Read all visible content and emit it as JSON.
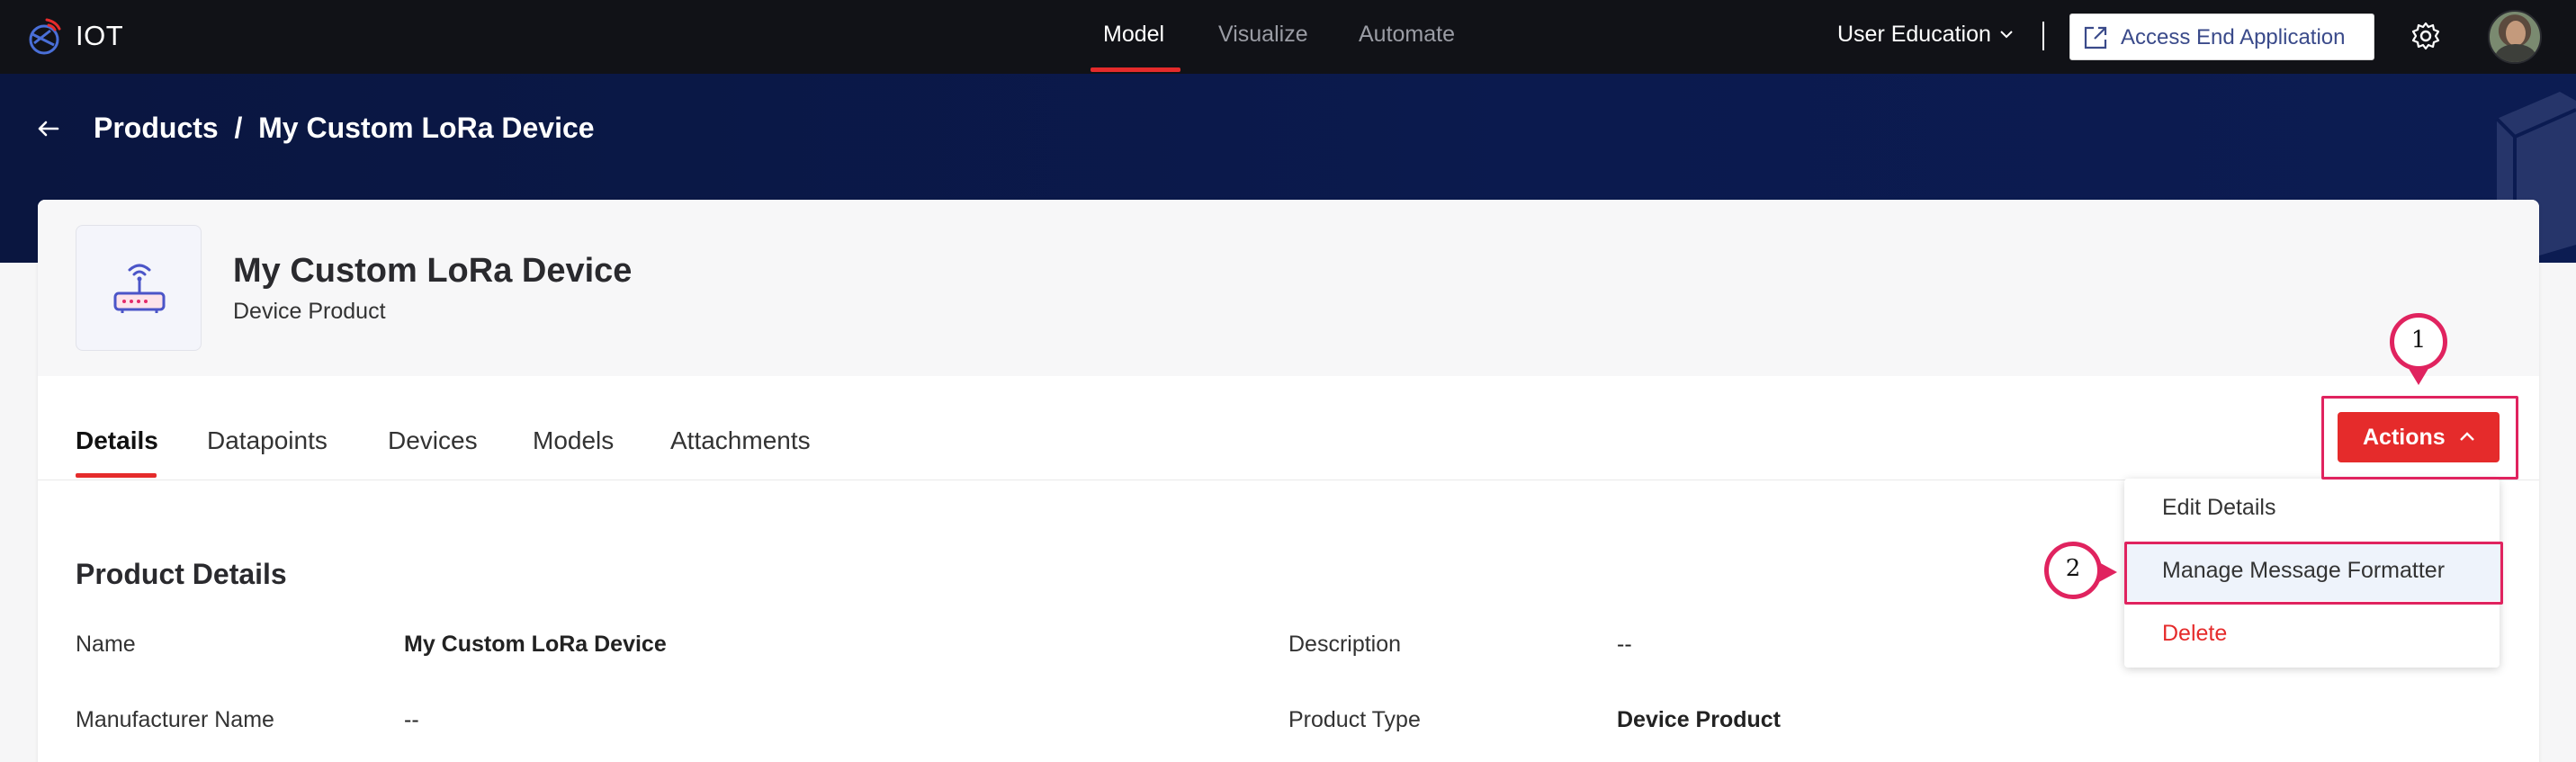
{
  "app": {
    "name": "IOT",
    "logo_icon": "zoho-iot-logo-icon"
  },
  "top_nav": {
    "items": [
      {
        "label": "Model",
        "active": true
      },
      {
        "label": "Visualize",
        "active": false
      },
      {
        "label": "Automate",
        "active": false
      }
    ],
    "org_label": "User Education",
    "access_button_label": "Access End Application",
    "settings_icon": "gear-icon"
  },
  "header": {
    "breadcrumb": "Products  /  My Custom LoRa Device",
    "back_icon": "arrow-left-icon"
  },
  "product": {
    "title": "My Custom LoRa Device",
    "subtitle": "Device Product",
    "icon": "router-icon"
  },
  "tabs": [
    {
      "label": "Details",
      "active": true
    },
    {
      "label": "Datapoints",
      "active": false
    },
    {
      "label": "Devices",
      "active": false
    },
    {
      "label": "Models",
      "active": false
    },
    {
      "label": "Attachments",
      "active": false
    }
  ],
  "actions": {
    "label": "Actions",
    "menu": [
      {
        "label": "Edit Details"
      },
      {
        "label": "Manage Message Formatter"
      },
      {
        "label": "Delete"
      }
    ]
  },
  "details": {
    "section_title": "Product Details",
    "rows": [
      {
        "label": "Name",
        "value": "My Custom LoRa Device"
      },
      {
        "label": "Description",
        "value": "--"
      },
      {
        "label": "Manufacturer Name",
        "value": "--"
      },
      {
        "label": "Product Type",
        "value": "Device Product"
      }
    ]
  },
  "annotations": {
    "step1": "1",
    "step2": "2",
    "color": "#e0235f"
  },
  "colors": {
    "accent": "#e52b2b",
    "topbar": "#111217",
    "header": "#0b1a4e"
  }
}
